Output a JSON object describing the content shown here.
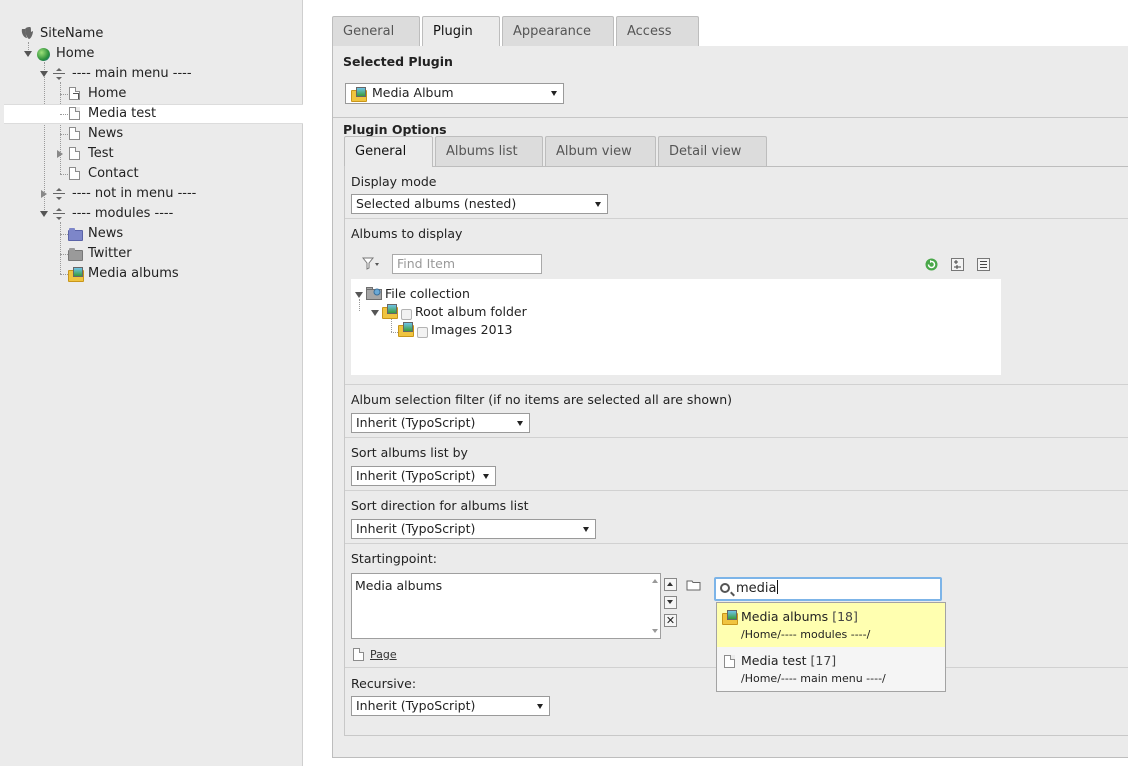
{
  "tree": {
    "site": "SiteName",
    "home": "Home",
    "main_menu": "---- main menu ----",
    "main_items": [
      "Home",
      "Media test",
      "News",
      "Test",
      "Contact"
    ],
    "not_in_menu": "---- not in menu ----",
    "modules": "---- modules ----",
    "module_items": [
      "News",
      "Twitter",
      "Media albums"
    ]
  },
  "tabs": [
    "General",
    "Plugin",
    "Appearance",
    "Access"
  ],
  "selected_plugin": {
    "header": "Selected Plugin",
    "value": "Media Album"
  },
  "plugin_options": {
    "header": "Plugin Options",
    "tabs": [
      "General",
      "Albums list",
      "Album view",
      "Detail view"
    ],
    "display_mode": {
      "label": "Display mode",
      "value": "Selected albums (nested)"
    },
    "albums_to_display": {
      "label": "Albums to display",
      "find_placeholder": "Find Item",
      "nodes": [
        "File collection",
        "Root album folder",
        "Images 2013"
      ]
    },
    "album_filter": {
      "label": "Album selection filter (if no items are selected all are shown)",
      "value": "Inherit (TypoScript)"
    },
    "sort_by": {
      "label": "Sort albums list by",
      "value": "Inherit (TypoScript)"
    },
    "sort_direction": {
      "label": "Sort direction for albums list",
      "value": "Inherit (TypoScript)"
    },
    "startingpoint": {
      "label": "Startingpoint:",
      "selected": "Media albums",
      "page_link": "Page",
      "search_value": "media",
      "suggestions": [
        {
          "title": "Media albums",
          "id": "[18]",
          "path": "/Home/---- modules ----/"
        },
        {
          "title": "Media test",
          "id": "[17]",
          "path": "/Home/---- main menu ----/"
        }
      ]
    },
    "recursive": {
      "label": "Recursive:",
      "value": "Inherit (TypoScript)"
    }
  }
}
